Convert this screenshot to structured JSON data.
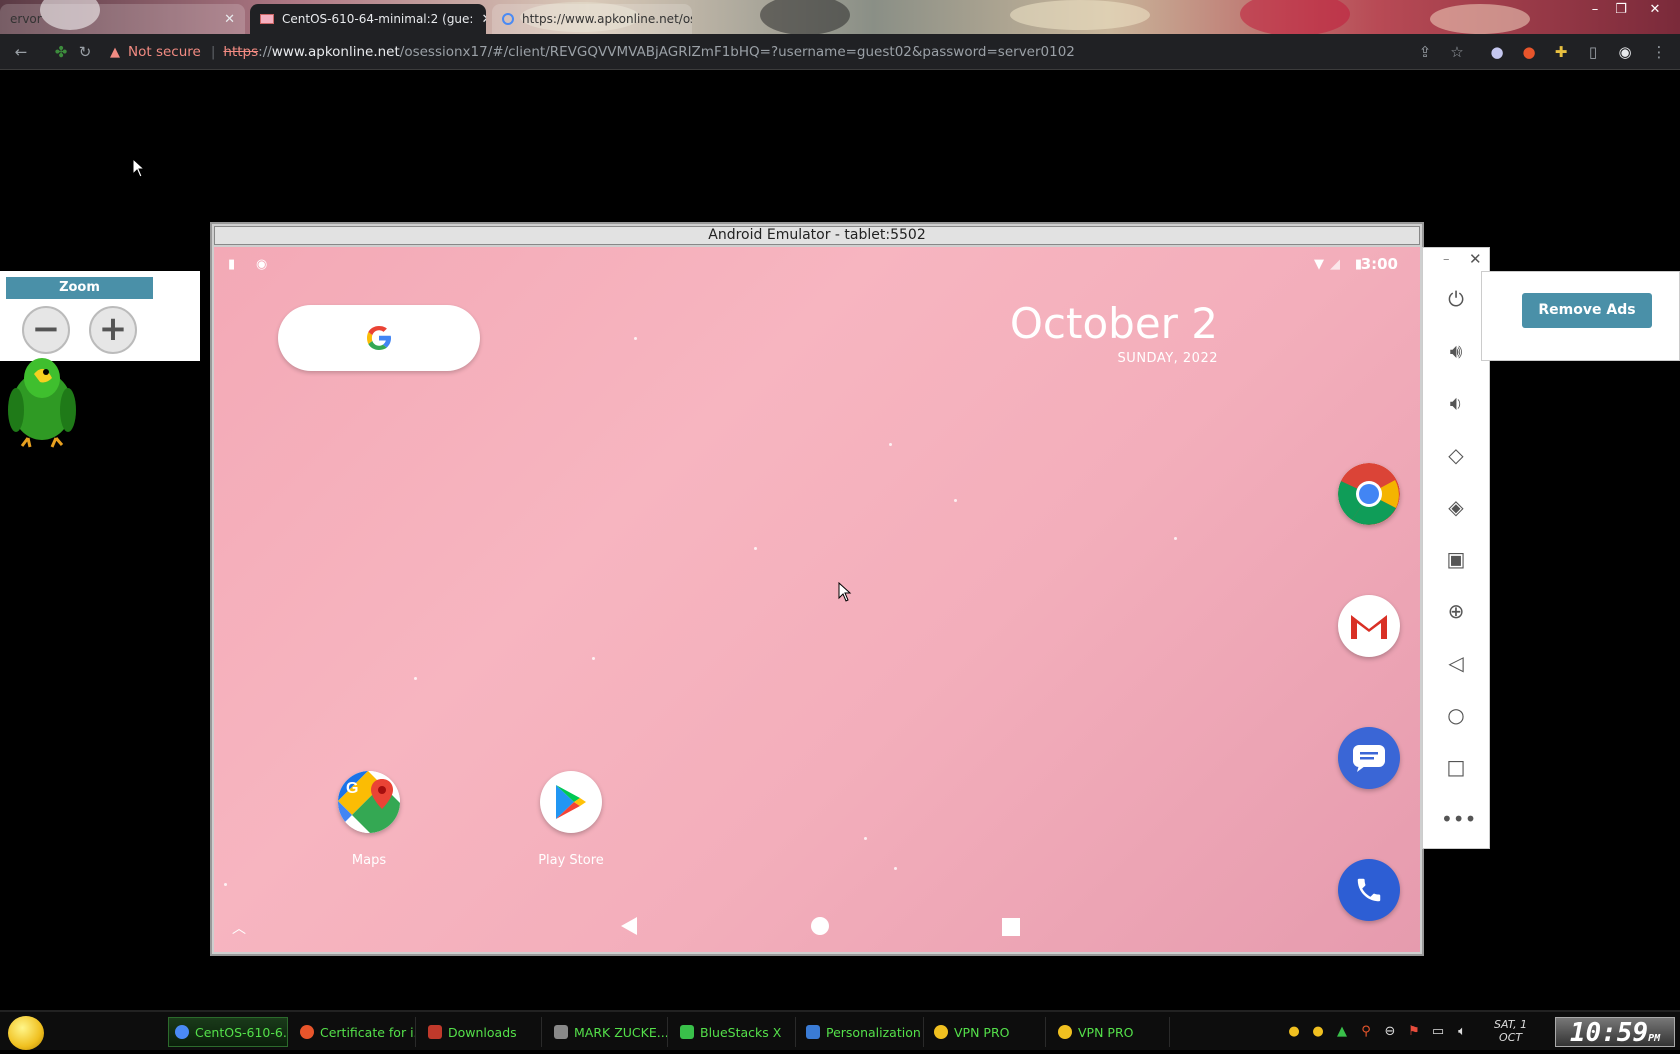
{
  "browser": {
    "tabs": [
      {
        "label": "ervor",
        "active": false
      },
      {
        "label": "CentOS-610-64-minimal:2 (gue:",
        "active": true
      },
      {
        "label": "https://www.apkonline.net/ose",
        "active": false
      }
    ],
    "window_controls": [
      "–",
      "❐",
      "✕"
    ],
    "omnibox": {
      "warning": "Not secure",
      "separator": "|",
      "scheme": "https",
      "scheme_suffix": "://",
      "host": "www.apkonline.net",
      "path": "/osessionx17/#/client/REVGQVVMVABjAGRIZmF1bHQ=?username=guest02&password=server0102"
    }
  },
  "zoom_panel": {
    "title": "Zoom",
    "minus": "−",
    "plus": "+"
  },
  "emulator": {
    "title": "Android Emulator - tablet:5502",
    "status_time": "3:00",
    "date_big": "October 2",
    "date_small": "SUNDAY, 2022",
    "apps": [
      {
        "label": "Maps"
      },
      {
        "label": "Play Store"
      }
    ],
    "dock": [
      "chrome-icon",
      "gmail-icon",
      "messages-icon",
      "phone-icon"
    ]
  },
  "side_toolbar": {
    "minimize": "–",
    "close": "✕",
    "items": [
      "power-icon",
      "volume-up-icon",
      "volume-down-icon",
      "rotate-left-icon",
      "rotate-right-icon",
      "camera-icon",
      "zoom-in-icon",
      "back-icon",
      "home-icon",
      "overview-icon",
      "more-icon"
    ]
  },
  "ad_panel": {
    "remove_ads": "Remove Ads"
  },
  "taskbar": {
    "items": [
      {
        "label": "CentOS-610-6...",
        "active": true,
        "color": "#4a8af4"
      },
      {
        "label": "Certificate for i...",
        "active": false,
        "color": "#e8552b"
      },
      {
        "label": "Downloads",
        "active": false,
        "color": "#c0392b"
      },
      {
        "label": "MARK ZUCKE...",
        "active": false,
        "color": "#888888"
      },
      {
        "label": "BlueStacks X",
        "active": false,
        "color": "#39c04a"
      },
      {
        "label": "Personalization",
        "active": false,
        "color": "#3a7bd5"
      },
      {
        "label": "VPN PRO",
        "active": false,
        "color": "#f0c020"
      },
      {
        "label": "VPN PRO",
        "active": false,
        "color": "#f0c020"
      }
    ],
    "date_line1": "SAT, 1",
    "date_line2": "OCT",
    "clock": "10:59",
    "clock_suffix": "PM"
  }
}
